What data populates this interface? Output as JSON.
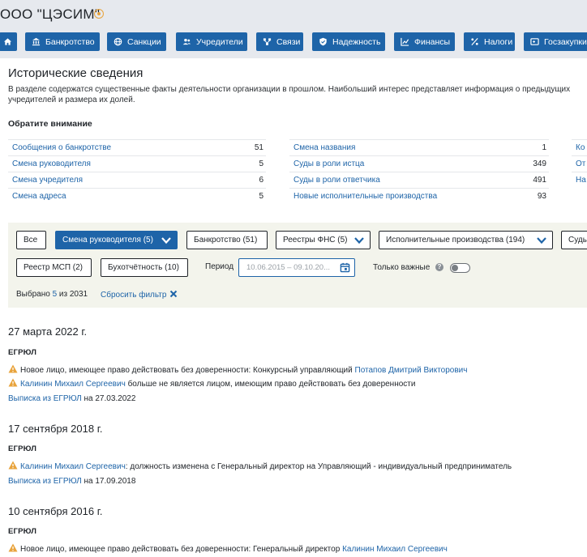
{
  "company": {
    "title": "ООО \"ЦЭСИМ\""
  },
  "nav": [
    {
      "label": "",
      "icon": "home-icon"
    },
    {
      "label": "Банкротство",
      "icon": "bank-icon"
    },
    {
      "label": "Санкции",
      "icon": "globe-icon"
    },
    {
      "label": "Учредители",
      "icon": "users-icon"
    },
    {
      "label": "Связи",
      "icon": "network-icon"
    },
    {
      "label": "Надежность",
      "icon": "shield-icon"
    },
    {
      "label": "Финансы",
      "icon": "chart-icon"
    },
    {
      "label": "Налоги",
      "icon": "percent-icon"
    },
    {
      "label": "Госзакупки",
      "icon": "procurement-icon"
    }
  ],
  "section": {
    "title": "Исторические сведения",
    "intro": "В разделе содержатся существенные факты деятельности организации в прошлом. Наибольший интерес представляет информация о предыдущих учредителей и размера их долей.",
    "attention": "Обратите внимание"
  },
  "stats": {
    "col1": [
      {
        "label": "Сообщения о банкротстве",
        "value": "51"
      },
      {
        "label": "Смена руководителя",
        "value": "5"
      },
      {
        "label": "Смена учредителя",
        "value": "6"
      },
      {
        "label": "Смена адреса",
        "value": "5"
      }
    ],
    "col2": [
      {
        "label": "Смена названия",
        "value": "1"
      },
      {
        "label": "Суды в роли истца",
        "value": "349"
      },
      {
        "label": "Суды в роли ответчика",
        "value": "491"
      },
      {
        "label": "Новые исполнительные производства",
        "value": "93"
      }
    ],
    "col3": [
      {
        "label": "Ко"
      },
      {
        "label": "От"
      },
      {
        "label": "На"
      }
    ]
  },
  "filters": {
    "row1": [
      {
        "label": "Все",
        "active": false
      },
      {
        "label": "Смена руководителя (5)",
        "active": true,
        "dropdown": true
      },
      {
        "label": "Банкротство (51)",
        "active": false
      },
      {
        "label": "Реестры ФНС (5)",
        "active": false,
        "dropdown": true
      },
      {
        "label": "Исполнительные производства (194)",
        "active": false,
        "dropdown": true
      },
      {
        "label": "Суды",
        "active": false
      }
    ],
    "row2": [
      {
        "label": "Реестр МСП (2)"
      },
      {
        "label": "Бухотчётность (10)"
      }
    ],
    "period_label": "Период",
    "period_value": "10.06.2015  –  09.10.20...",
    "important_label": "Только важные",
    "important_on": false,
    "selected_prefix": "Выбрано",
    "selected_count": "5",
    "selected_suffix": "из 2031",
    "reset_label": "Сбросить фильтр"
  },
  "events": [
    {
      "date": "27 марта 2022 г.",
      "source": "ЕГРЮЛ",
      "items": [
        {
          "pre": "Новое лицо, имеющее право действовать без доверенности: Конкурсный управляющий ",
          "link": "Потапов Дмитрий Викторович",
          "post": ""
        },
        {
          "pre": "",
          "link": "Калинин Михаил Сергеевич",
          "post": " больше не является лицом, имеющим право действовать без доверенности"
        }
      ],
      "extract_link": "Выписка из ЕГРЮЛ",
      "extract_date": " на 27.03.2022"
    },
    {
      "date": "17 сентября 2018 г.",
      "source": "ЕГРЮЛ",
      "items": [
        {
          "pre": "",
          "link": "Калинин Михаил Сергеевич",
          "post": ": должность изменена с Генеральный директор на Управляющий - индивидуальный предприниматель"
        }
      ],
      "extract_link": "Выписка из ЕГРЮЛ",
      "extract_date": " на 17.09.2018"
    },
    {
      "date": "10 сентября 2016 г.",
      "source": "ЕГРЮЛ",
      "items": [
        {
          "pre": "Новое лицо, имеющее право действовать без доверенности: Генеральный директор ",
          "link": "Калинин Михаил Сергеевич",
          "post": ""
        }
      ]
    }
  ],
  "colors": {
    "accent": "#1e64a8",
    "warning": "#e8a33b",
    "header_bg": "#e6e9ee",
    "filter_bg": "#f3f4ec"
  }
}
